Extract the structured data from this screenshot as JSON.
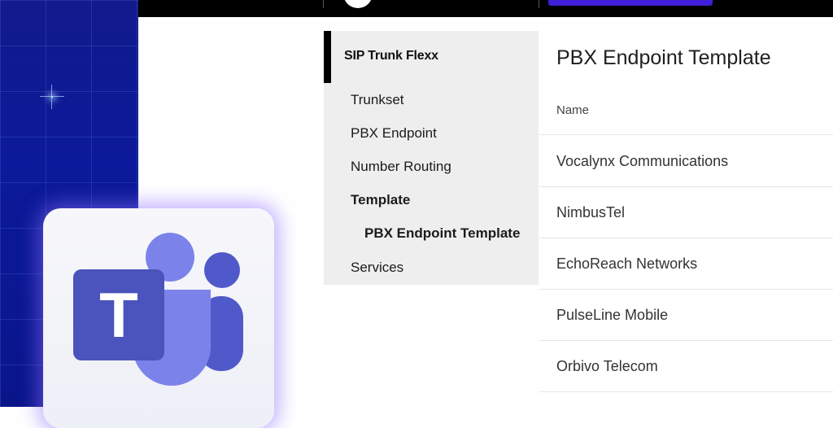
{
  "nav": {
    "section_title": "SIP Trunk Flexx",
    "items": [
      {
        "label": "Trunkset"
      },
      {
        "label": "PBX Endpoint"
      },
      {
        "label": "Number Routing"
      },
      {
        "label": "Template"
      },
      {
        "label": "PBX Endpoint Template"
      },
      {
        "label": "Services"
      }
    ]
  },
  "main": {
    "title": "PBX Endpoint Template",
    "column_header": "Name",
    "rows": [
      "Vocalynx Communications",
      "NimbusTel",
      "EchoReach Networks",
      "PulseLine Mobile",
      "Orbivo Telecom"
    ]
  },
  "logo": {
    "icon": "teams-logo-icon",
    "letter": "T",
    "colors": {
      "tile": "#4b53bc",
      "person_front": "#7b83eb",
      "person_back": "#5059c9"
    }
  },
  "colors": {
    "accent_button": "#3f1fd9",
    "background_panel": "#0b1a9a",
    "nav_background": "#eeeeef"
  }
}
